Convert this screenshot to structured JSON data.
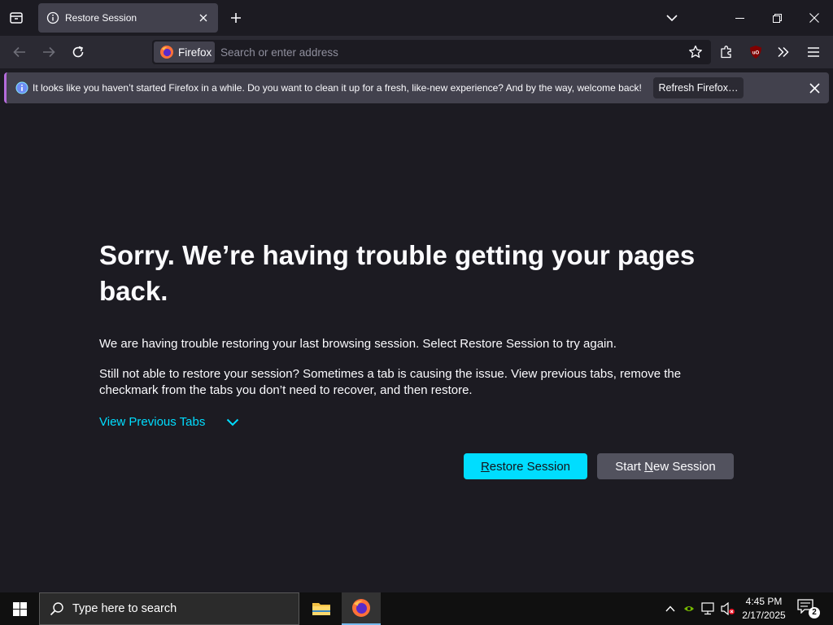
{
  "browser": {
    "tab": {
      "title": "Restore Session"
    },
    "urlbar": {
      "identity_label": "Firefox",
      "placeholder": "Search or enter address"
    }
  },
  "notification": {
    "message": "It looks like you haven’t started Firefox in a while. Do you want to clean it up for a fresh, like-new experience? And by the way, welcome back!",
    "button_label": "Refresh Firefox…"
  },
  "page": {
    "title": "Sorry. We’re having trouble getting your pages back.",
    "description_1": "We are having trouble restoring your last browsing session. Select Restore Session to try again.",
    "description_2": "Still not able to restore your session? Sometimes a tab is causing the issue. View previous tabs, remove the checkmark from the tabs you don’t need to recover, and then restore.",
    "view_previous_label": "View Previous Tabs",
    "restore_button": {
      "accesskey": "R",
      "rest": "estore Session"
    },
    "new_session_button": {
      "before": "Start ",
      "accesskey": "N",
      "rest": "ew Session"
    }
  },
  "taskbar": {
    "search_placeholder": "Type here to search",
    "time": "4:45 PM",
    "date": "2/17/2025",
    "notification_count": "2"
  },
  "colors": {
    "accent": "#00ddff",
    "background": "#1c1b22",
    "toolbar": "#2b2a33",
    "notification_border": "#b56cdb"
  }
}
